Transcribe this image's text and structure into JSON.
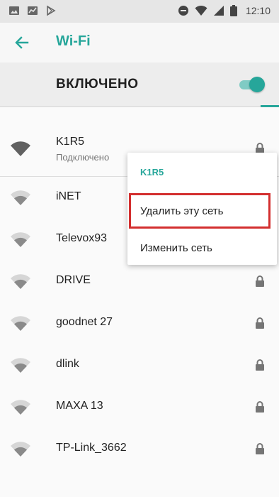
{
  "status_bar": {
    "time": "12:10",
    "left_icons": [
      "image-icon",
      "chart-icon",
      "play-store-icon"
    ],
    "right_icons": [
      "do-not-disturb-icon",
      "wifi-icon",
      "cell-signal-icon",
      "battery-icon"
    ]
  },
  "app_bar": {
    "title": "Wi-Fi",
    "back_icon": "arrow-back-icon",
    "accent_color": "#26a69a"
  },
  "master_switch": {
    "label": "ВКЛЮЧЕНО",
    "state": "on"
  },
  "networks": [
    {
      "name": "K1R5",
      "status": "Подключено",
      "secured": true
    },
    {
      "name": "iNET",
      "status": "",
      "secured": false
    },
    {
      "name": "Televox93",
      "status": "",
      "secured": false
    },
    {
      "name": "DRIVE",
      "status": "",
      "secured": true
    },
    {
      "name": "goodnet 27",
      "status": "",
      "secured": true
    },
    {
      "name": "dlink",
      "status": "",
      "secured": true
    },
    {
      "name": "MAXA 13",
      "status": "",
      "secured": true
    },
    {
      "name": "TP-Link_3662",
      "status": "",
      "secured": true
    }
  ],
  "context_menu": {
    "title": "K1R5",
    "items": [
      "Удалить эту сеть",
      "Изменить сеть"
    ],
    "highlighted_item": "Удалить эту сеть",
    "highlight_color": "#d32f2f"
  }
}
